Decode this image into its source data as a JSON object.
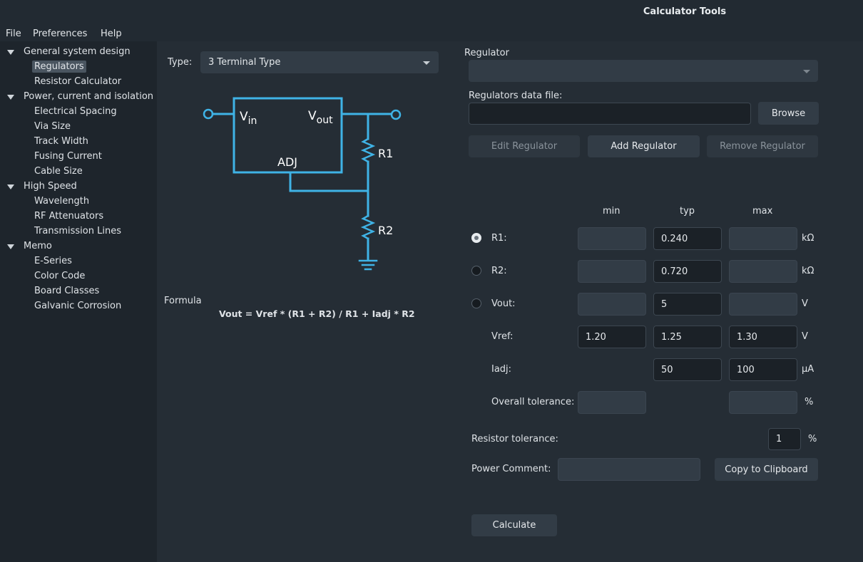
{
  "window": {
    "title": "Calculator Tools"
  },
  "menu": {
    "file": "File",
    "preferences": "Preferences",
    "help": "Help"
  },
  "sidebar": {
    "groups": [
      {
        "label": "General system design",
        "items": [
          "Regulators",
          "Resistor Calculator"
        ]
      },
      {
        "label": "Power, current and isolation",
        "items": [
          "Electrical Spacing",
          "Via Size",
          "Track Width",
          "Fusing Current",
          "Cable Size"
        ]
      },
      {
        "label": "High Speed",
        "items": [
          "Wavelength",
          "RF Attenuators",
          "Transmission Lines"
        ]
      },
      {
        "label": "Memo",
        "items": [
          "E-Series",
          "Color Code",
          "Board Classes",
          "Galvanic Corrosion"
        ]
      }
    ],
    "selected": "Regulators"
  },
  "type_selector": {
    "label": "Type:",
    "value": "3 Terminal Type"
  },
  "schematic": {
    "vin": "V",
    "vin_sub": "in",
    "vout": "V",
    "vout_sub": "out",
    "adj": "ADJ",
    "r1": "R1",
    "r2": "R2"
  },
  "formula": {
    "label": "Formula",
    "text": "Vout = Vref * (R1 + R2) / R1 + Iadj * R2"
  },
  "regulator": {
    "label": "Regulator",
    "selected": "",
    "data_file_label": "Regulators data file:",
    "data_file_value": "",
    "browse": "Browse",
    "edit": "Edit Regulator",
    "add": "Add Regulator",
    "remove": "Remove Regulator"
  },
  "params": {
    "headers": {
      "min": "min",
      "typ": "typ",
      "max": "max"
    },
    "rows": [
      {
        "label": "R1:",
        "min": "",
        "typ": "0.240",
        "max": "",
        "unit": "kΩ"
      },
      {
        "label": "R2:",
        "min": "",
        "typ": "0.720",
        "max": "",
        "unit": "kΩ"
      },
      {
        "label": "Vout:",
        "min": "",
        "typ": "5",
        "max": "",
        "unit": "V"
      },
      {
        "label": "Vref:",
        "min": "1.20",
        "typ": "1.25",
        "max": "1.30",
        "unit": "V"
      },
      {
        "label": "Iadj:",
        "min": "",
        "typ": "50",
        "max": "100",
        "unit": "µA"
      },
      {
        "label": "Overall tolerance:",
        "min": "",
        "typ": "",
        "max": "",
        "unit": "%"
      }
    ],
    "selected_radio": "R1"
  },
  "resistor_tolerance": {
    "label": "Resistor tolerance:",
    "value": "1",
    "unit": "%"
  },
  "power_comment": {
    "label": "Power Comment:",
    "value": "",
    "copy": "Copy to Clipboard"
  },
  "calculate": "Calculate",
  "colors": {
    "schematic": "#3fb3e6",
    "background": "#252d35",
    "sidebar": "#1e252c"
  }
}
